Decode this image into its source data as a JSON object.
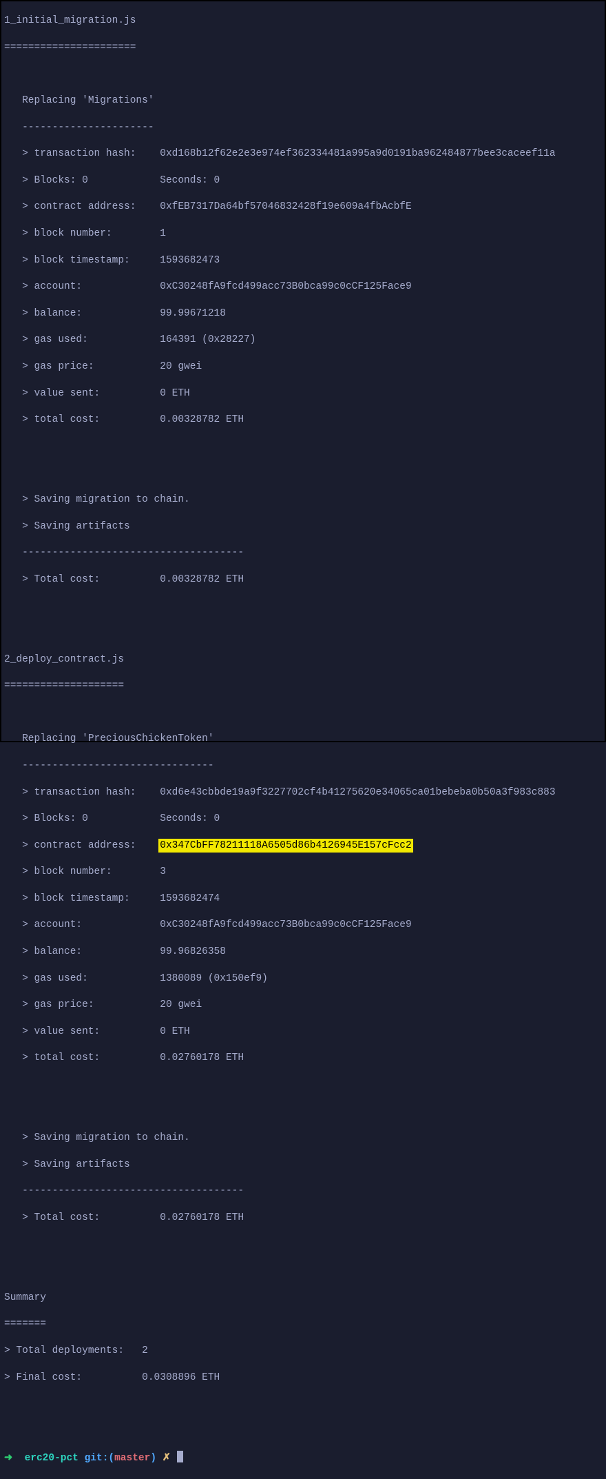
{
  "migration1": {
    "file": "1_initial_migration.js",
    "file_ul": "======================",
    "replacing": "   Replacing 'Migrations'",
    "replacing_ul": "   ----------------------",
    "tx_hash_k": "   > transaction hash:    ",
    "tx_hash_v": "0xd168b12f62e2e3e974ef362334481a995a9d0191ba962484877bee3caceef11a",
    "blocks": "   > Blocks: 0            Seconds: 0",
    "addr_k": "   > contract address:    ",
    "addr_v": "0xfEB7317Da64bf57046832428f19e609a4fbAcbfE",
    "blocknum": "   > block number:        1",
    "ts": "   > block timestamp:     1593682473",
    "acct": "   > account:             0xC30248fA9fcd499acc73B0bca99c0cCF125Face9",
    "bal": "   > balance:             99.99671218",
    "gas": "   > gas used:            164391 (0x28227)",
    "gprice": "   > gas price:           20 gwei",
    "vsent": "   > value sent:          0 ETH",
    "tcost": "   > total cost:          0.00328782 ETH",
    "save1": "   > Saving migration to chain.",
    "save2": "   > Saving artifacts",
    "save_ul": "   -------------------------------------",
    "finalc": "   > Total cost:          0.00328782 ETH"
  },
  "migration2": {
    "file": "2_deploy_contract.js",
    "file_ul": "====================",
    "replacing": "   Replacing 'PreciousChickenToken'",
    "replacing_ul": "   --------------------------------",
    "tx_hash_k": "   > transaction hash:    ",
    "tx_hash_v": "0xd6e43cbbde19a9f3227702cf4b41275620e34065ca01bebeba0b50a3f983c883",
    "blocks": "   > Blocks: 0            Seconds: 0",
    "addr_k": "   > contract address:    ",
    "addr_v": "0x347CbFF78211118A6505d86b4126945E157cFcc2",
    "blocknum": "   > block number:        3",
    "ts": "   > block timestamp:     1593682474",
    "acct": "   > account:             0xC30248fA9fcd499acc73B0bca99c0cCF125Face9",
    "bal": "   > balance:             99.96826358",
    "gas": "   > gas used:            1380089 (0x150ef9)",
    "gprice": "   > gas price:           20 gwei",
    "vsent": "   > value sent:          0 ETH",
    "tcost": "   > total cost:          0.02760178 ETH",
    "save1": "   > Saving migration to chain.",
    "save2": "   > Saving artifacts",
    "save_ul": "   -------------------------------------",
    "finalc": "   > Total cost:          0.02760178 ETH"
  },
  "summary": {
    "title": "Summary",
    "ul": "=======",
    "deploy": "> Total deployments:   2",
    "final": "> Final cost:          0.0308896 ETH"
  },
  "prompt": {
    "arrow": "➜  ",
    "dir": "erc20-pct",
    "git": " git:",
    "lparen": "(",
    "branch": "master",
    "rparen": ")",
    "x": " ✗ "
  }
}
